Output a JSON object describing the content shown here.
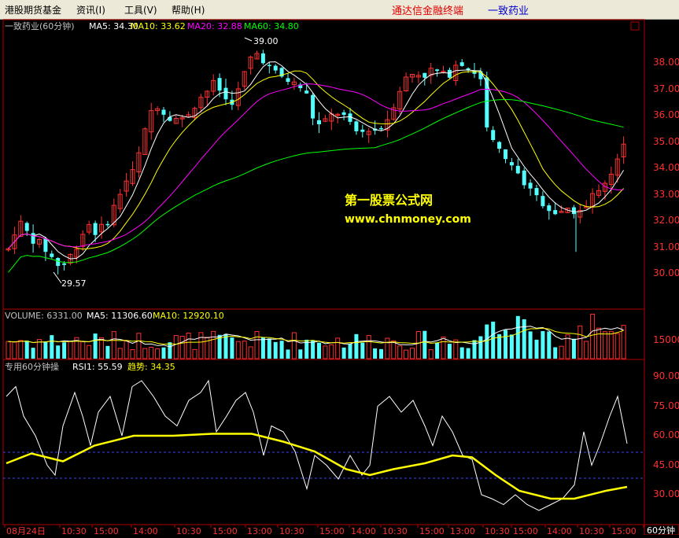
{
  "menu": {
    "items": [
      "港股期货基金",
      "资讯(I)",
      "工具(V)",
      "帮助(H)"
    ],
    "brand": "通达信金融终端",
    "stock_name": "一致药业"
  },
  "watermark": {
    "line1": "第一股票公式网",
    "line2": "www.chnmoney.com"
  },
  "price_panel": {
    "title": "一致药业(60分钟)",
    "indicators": [
      {
        "label": "MA5: 34.30",
        "color": "#ffffff"
      },
      {
        "label": "MA10: 33.62",
        "color": "#ffff00"
      },
      {
        "label": "MA20: 32.88",
        "color": "#ff00ff"
      },
      {
        "label": "MA60: 34.80",
        "color": "#00ff00"
      }
    ],
    "high_label": "39.00",
    "low_label": "29.57",
    "axis_ticks": [
      "38.00",
      "37.00",
      "36.00",
      "35.00",
      "34.00",
      "33.00",
      "32.00",
      "31.00",
      "30.00"
    ]
  },
  "volume_panel": {
    "indicators": [
      {
        "label": "VOLUME: 6331.00",
        "color": "#ffffff"
      },
      {
        "label": "MA5: 11306.60",
        "color": "#ffffff"
      },
      {
        "label": "MA10: 12920.10",
        "color": "#ffff00"
      }
    ],
    "axis_ticks": [
      "15000"
    ]
  },
  "rsi_panel": {
    "title": "专用60分钟操",
    "indicators": [
      {
        "label": "RSI1: 55.59",
        "color": "#ffffff"
      },
      {
        "label": "趋势: 34.35",
        "color": "#ffff00"
      }
    ],
    "axis_ticks": [
      "90.00",
      "75.00",
      "60.00",
      "45.00",
      "30.00"
    ]
  },
  "x_axis": {
    "labels": [
      "08月24日",
      "10:30",
      "15:00",
      "14:00",
      "10:30",
      "15:00",
      "13:00",
      "10:30",
      "15:00",
      "14:00",
      "10:30",
      "15:00",
      "13:00",
      "10:30",
      "15:00",
      "14:00",
      "10:30",
      "15:00",
      "13:00",
      "10:30"
    ],
    "period": "60分钟"
  },
  "colors": {
    "up": "#ff3030",
    "down": "#54ffff",
    "ma5": "#ffffff",
    "ma10": "#ffff00",
    "ma20": "#ff00ff",
    "ma60": "#00ff00",
    "frame": "#b00000"
  }
}
